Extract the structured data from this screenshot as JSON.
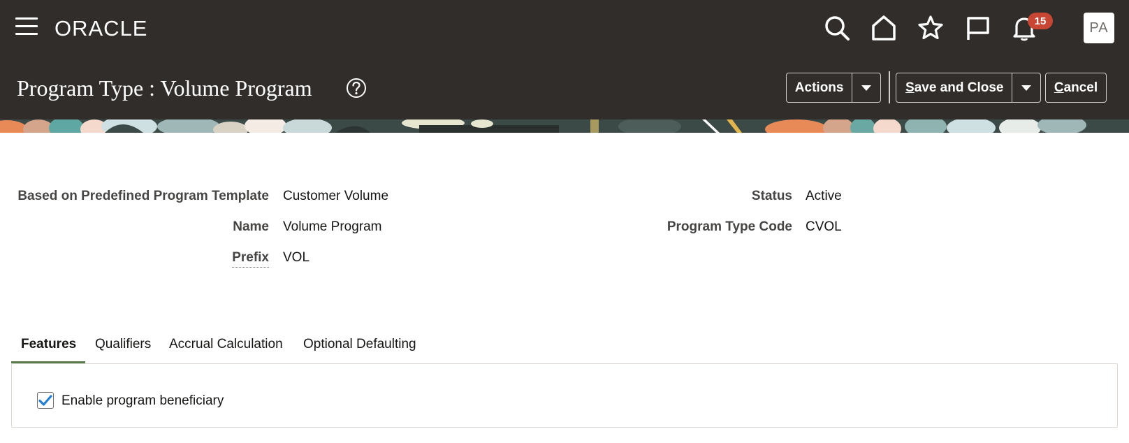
{
  "header": {
    "brand": "ORACLE",
    "notification_count": "15",
    "avatar_initials": "PA"
  },
  "title_bar": {
    "title": "Program Type : Volume Program",
    "actions_label": "Actions",
    "save_close_first": "S",
    "save_close_rest": "ave and Close",
    "cancel_first": "C",
    "cancel_rest": "ancel"
  },
  "form": {
    "template_label": "Based on Predefined Program Template",
    "template_value": "Customer Volume",
    "name_label": "Name",
    "name_value": "Volume Program",
    "prefix_label": "Prefix",
    "prefix_value": "VOL",
    "status_label": "Status",
    "status_value": "Active",
    "code_label": "Program Type Code",
    "code_value": "CVOL"
  },
  "tabs": [
    {
      "label": "Features",
      "active": true
    },
    {
      "label": "Qualifiers",
      "active": false
    },
    {
      "label": "Accrual Calculation",
      "active": false
    },
    {
      "label": "Optional Defaulting",
      "active": false
    }
  ],
  "features": {
    "enable_beneficiary_label": "Enable program beneficiary",
    "enable_beneficiary_checked": true
  },
  "colors": {
    "header_bg": "#312d2a",
    "badge": "#c74634",
    "tab_accent": "#5a7e4a",
    "checkbox_check": "#227ed2"
  }
}
